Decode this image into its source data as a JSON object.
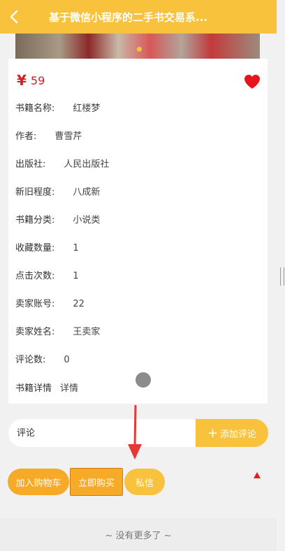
{
  "header": {
    "title": "基于微信小程序的二手书交易系...",
    "back_icon": "chevron-left-icon",
    "background_color": "#f9c23c"
  },
  "carousel": {
    "active_index": 1,
    "indicator_color": "#f9c23c"
  },
  "price": {
    "symbol": "¥",
    "value": "59",
    "color": "#d0212b"
  },
  "favorite": {
    "icon": "heart-icon",
    "color": "#e8141c"
  },
  "details": [
    {
      "label": "书籍名称:",
      "value": "红楼梦"
    },
    {
      "label": "作者:",
      "value": "曹雪芹"
    },
    {
      "label": "出版社:",
      "value": "人民出版社"
    },
    {
      "label": "新旧程度:",
      "value": "八成新"
    },
    {
      "label": "书籍分类:",
      "value": "小说类"
    },
    {
      "label": "收藏数量:",
      "value": "1"
    },
    {
      "label": "点击次数:",
      "value": "1"
    },
    {
      "label": "卖家账号:",
      "value": "22"
    },
    {
      "label": "卖家姓名:",
      "value": "王卖家"
    },
    {
      "label": "评论数:",
      "value": "0"
    },
    {
      "label": "书籍详情",
      "value": "详情"
    }
  ],
  "comment": {
    "placeholder": "评论",
    "add_label": "添加评论",
    "add_icon": "plus-icon"
  },
  "actions": {
    "cart_label": "加入购物车",
    "buy_label": "立即购买",
    "message_label": "私信"
  },
  "footer": {
    "text": "~ 没有更多了 ~"
  },
  "overlays": {
    "arrow_color": "#e53935",
    "scroll_top_icon": "triangle-up-icon"
  }
}
